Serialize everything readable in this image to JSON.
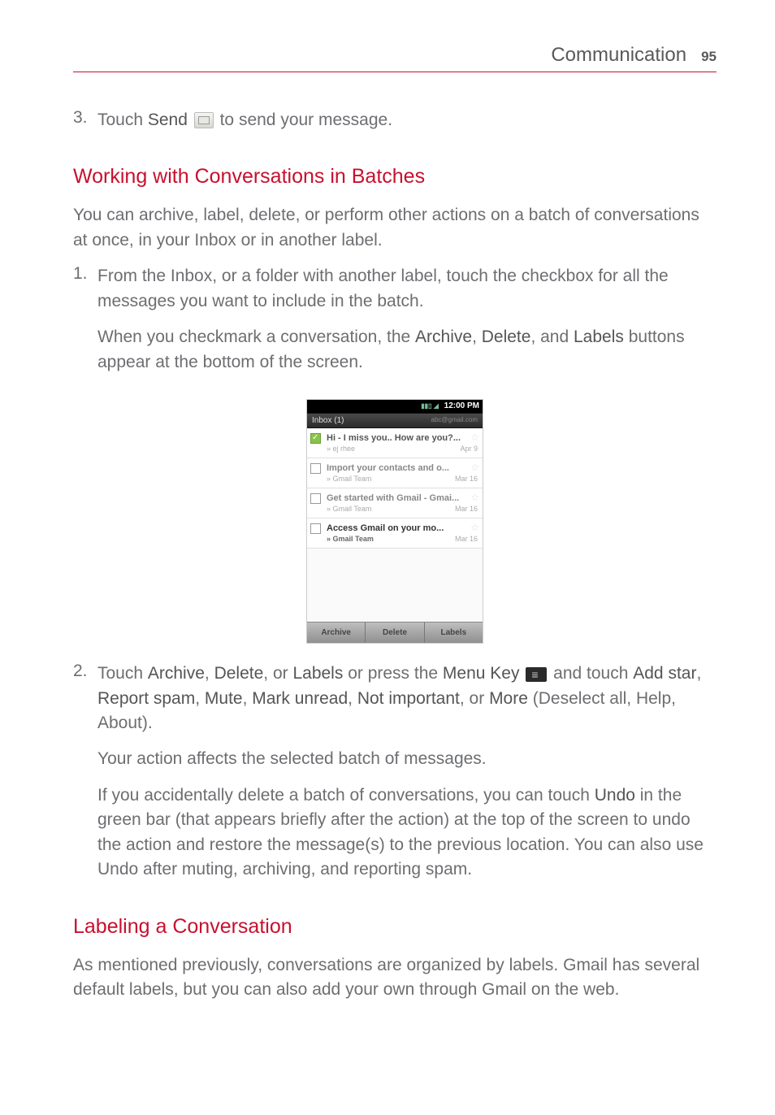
{
  "header": {
    "section": "Communication",
    "page": "95"
  },
  "step3": {
    "num": "3.",
    "t1": "Touch ",
    "b1": "Send",
    "t2": " to send your message."
  },
  "h1": "Working with Conversations in Batches",
  "p1": "You can archive, label, delete, or perform other actions on a batch of conversations at once, in your Inbox or in another label.",
  "step1": {
    "num": "1.",
    "p1": "From the Inbox, or a folder with another label, touch the checkbox for all the messages you want to include in the batch.",
    "p2a": "When you checkmark a conversation, the ",
    "b1": "Archive",
    "sep1": ", ",
    "b2": "Delete",
    "sep2": ", and ",
    "b3": "Labels",
    "p2b": " buttons appear at the bottom of the screen."
  },
  "phone": {
    "time": "12:00 PM",
    "inbox_label": "Inbox (1)",
    "account": "abc@gmail.com",
    "rows": [
      {
        "subj": "Hi - I miss you.. How are you?...",
        "from": "» ej rhee",
        "date": "Apr 9"
      },
      {
        "subj": "Import your contacts and o...",
        "from": "» Gmail Team",
        "date": "Mar 16"
      },
      {
        "subj": "Get started with Gmail - Gmai...",
        "from": "» Gmail Team",
        "date": "Mar 16"
      },
      {
        "subj": "Access Gmail on your mo...",
        "from": "» Gmail Team",
        "date": "Mar 16"
      }
    ],
    "buttons": {
      "archive": "Archive",
      "delete": "Delete",
      "labels": "Labels"
    }
  },
  "step2": {
    "num": "2.",
    "t1": "Touch ",
    "b1": "Archive",
    "s1": ", ",
    "b2": "Delete",
    "s2": ", or ",
    "b3": "Labels",
    "t2": " or press the ",
    "b4": "Menu Key",
    "t3": " and touch ",
    "b5": "Add star",
    "s3": ", ",
    "b6": "Report spam",
    "s4": ", ",
    "b7": "Mute",
    "s5": ", ",
    "b8": "Mark unread",
    "s6": ", ",
    "b9": "Not important",
    "s7": ", or ",
    "b10": "More",
    "t4": " (Deselect all, Help, About).",
    "p2": "Your action affects the selected batch of messages.",
    "p3a": "If you accidentally delete a batch of conversations, you can touch ",
    "b11": "Undo",
    "p3b": " in the green bar (that appears briefly after the action) at the top of the screen to undo the action and restore the message(s) to the previous location. You can also use Undo after muting, archiving, and reporting spam."
  },
  "h2": "Labeling a Conversation",
  "p2": "As mentioned previously, conversations are organized by labels. Gmail has several default labels, but you can also add your own through Gmail on the web."
}
